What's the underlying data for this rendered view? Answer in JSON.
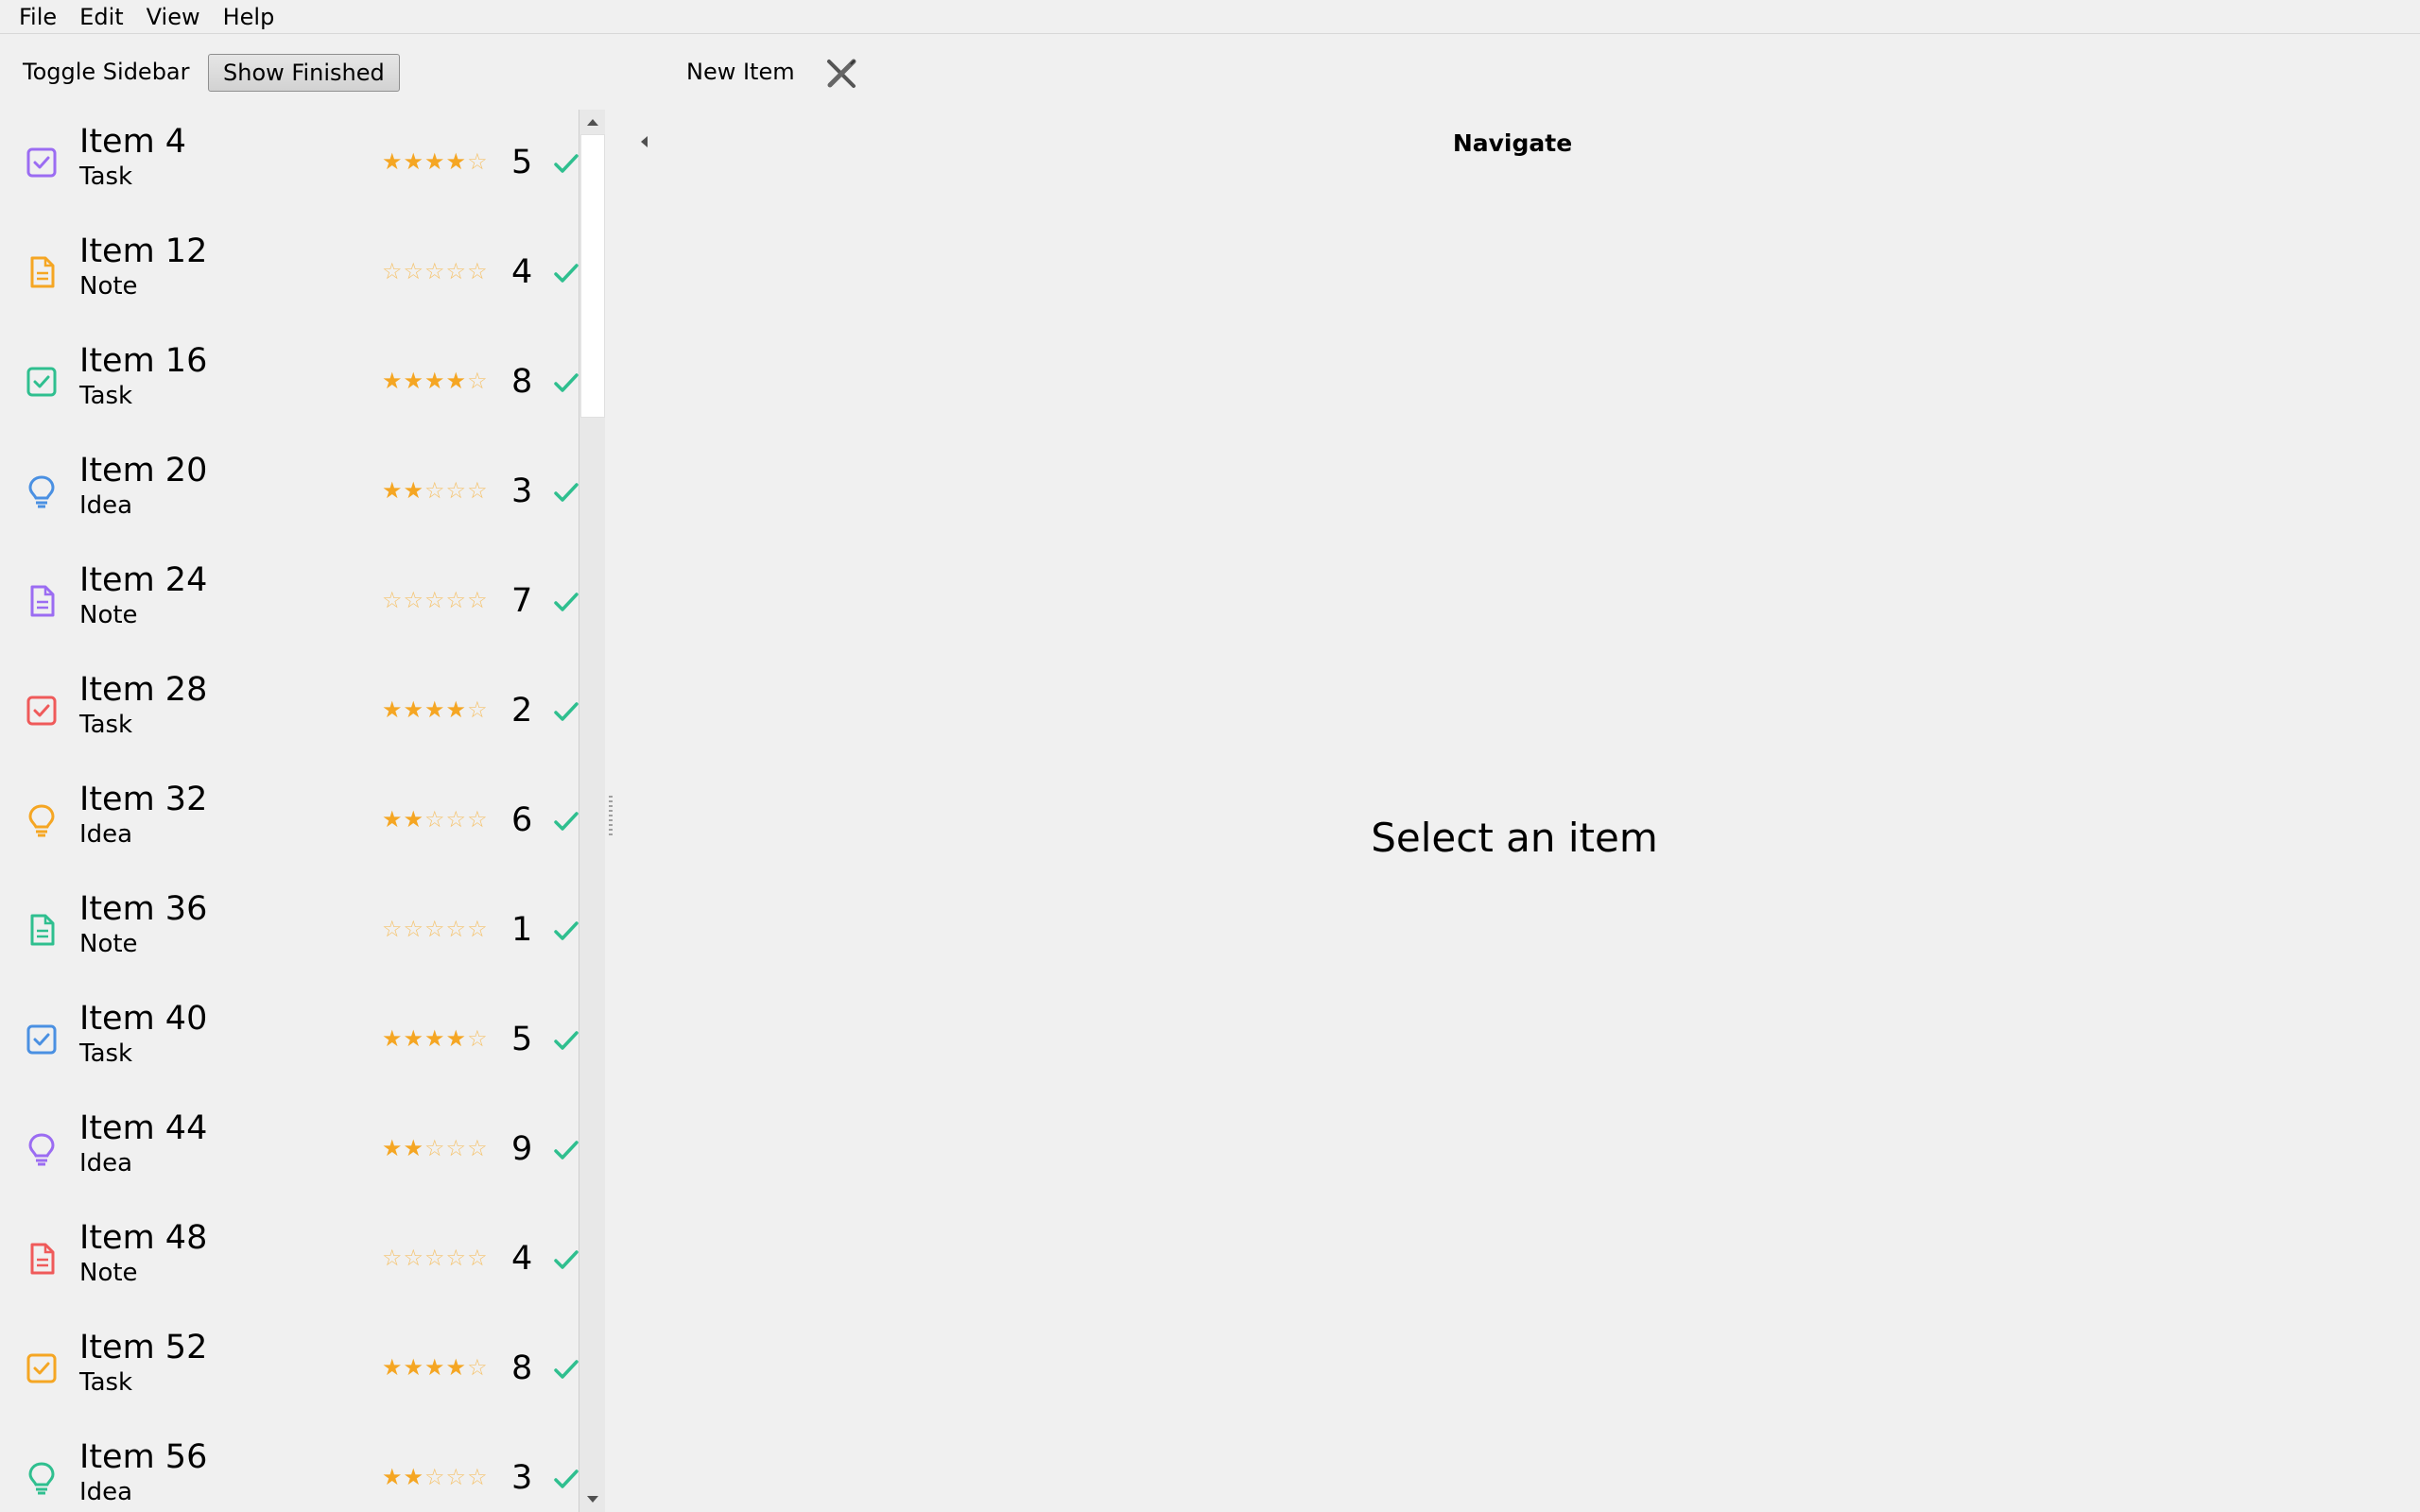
{
  "menu": {
    "items": [
      "File",
      "Edit",
      "View",
      "Help"
    ]
  },
  "toolbar": {
    "toggle_sidebar": "Toggle Sidebar",
    "show_finished": "Show Finished",
    "new_item": "New Item",
    "tool_icon": "pencil-cross-icon"
  },
  "colors": {
    "purple": "#9b6cf2",
    "orange": "#f5a623",
    "green": "#2fbf8f",
    "blue": "#4a90e2",
    "red": "#ef5a5a",
    "star": "#f5a623",
    "check": "#2fbf8f"
  },
  "items": [
    {
      "title": "Item 4",
      "type": "Task",
      "icon": "task-icon",
      "color": "#9b6cf2",
      "rating": 4,
      "count": "5"
    },
    {
      "title": "Item 12",
      "type": "Note",
      "icon": "note-icon",
      "color": "#f5a623",
      "rating": 0,
      "count": "4"
    },
    {
      "title": "Item 16",
      "type": "Task",
      "icon": "task-icon",
      "color": "#2fbf8f",
      "rating": 4,
      "count": "8"
    },
    {
      "title": "Item 20",
      "type": "Idea",
      "icon": "idea-icon",
      "color": "#4a90e2",
      "rating": 2,
      "count": "3"
    },
    {
      "title": "Item 24",
      "type": "Note",
      "icon": "note-icon",
      "color": "#9b6cf2",
      "rating": 0,
      "count": "7"
    },
    {
      "title": "Item 28",
      "type": "Task",
      "icon": "task-icon",
      "color": "#ef5a5a",
      "rating": 4,
      "count": "2"
    },
    {
      "title": "Item 32",
      "type": "Idea",
      "icon": "idea-icon",
      "color": "#f5a623",
      "rating": 2,
      "count": "6"
    },
    {
      "title": "Item 36",
      "type": "Note",
      "icon": "note-icon",
      "color": "#2fbf8f",
      "rating": 0,
      "count": "1"
    },
    {
      "title": "Item 40",
      "type": "Task",
      "icon": "task-icon",
      "color": "#4a90e2",
      "rating": 4,
      "count": "5"
    },
    {
      "title": "Item 44",
      "type": "Idea",
      "icon": "idea-icon",
      "color": "#9b6cf2",
      "rating": 2,
      "count": "9"
    },
    {
      "title": "Item 48",
      "type": "Note",
      "icon": "note-icon",
      "color": "#ef5a5a",
      "rating": 0,
      "count": "4"
    },
    {
      "title": "Item 52",
      "type": "Task",
      "icon": "task-icon",
      "color": "#f5a623",
      "rating": 4,
      "count": "8"
    },
    {
      "title": "Item 56",
      "type": "Idea",
      "icon": "idea-icon",
      "color": "#2fbf8f",
      "rating": 2,
      "count": "3"
    }
  ],
  "scrollbar": {
    "position": 0.0,
    "visible_fraction": 0.2
  },
  "main": {
    "nav_title": "Navigate",
    "placeholder": "Select an item"
  }
}
